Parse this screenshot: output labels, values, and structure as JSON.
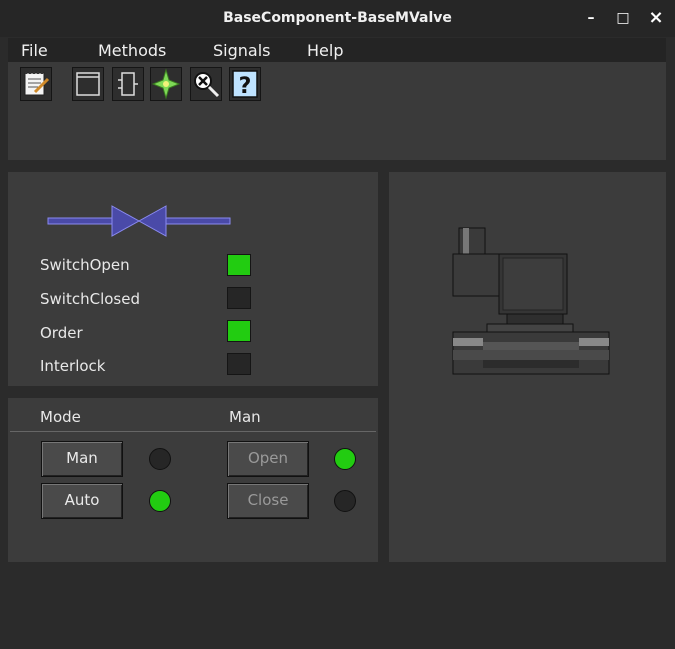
{
  "window": {
    "title": "BaseComponent-BaseMValve",
    "minimize": "–",
    "maximize": "□",
    "close": "×"
  },
  "menu": [
    "File",
    "Methods",
    "Signals",
    "Help"
  ],
  "toolbar": [
    "notepad-icon",
    "window-icon",
    "component-icon",
    "star-icon",
    "search-close-icon",
    "help-icon"
  ],
  "toolbar_help_glyph": "?",
  "signals": [
    {
      "label": "SwitchOpen",
      "on": true
    },
    {
      "label": "SwitchClosed",
      "on": false
    },
    {
      "label": "Order",
      "on": true
    },
    {
      "label": "Interlock",
      "on": false
    }
  ],
  "mode": {
    "header": "Mode",
    "man_header": "Man",
    "man_label": "Man",
    "man_led": false,
    "auto_label": "Auto",
    "auto_led": true,
    "open_label": "Open",
    "open_led": true,
    "close_label": "Close",
    "close_led": false
  },
  "colors": {
    "on": "#22cc11",
    "off": "#262626",
    "valve": "#4a4aa8"
  }
}
